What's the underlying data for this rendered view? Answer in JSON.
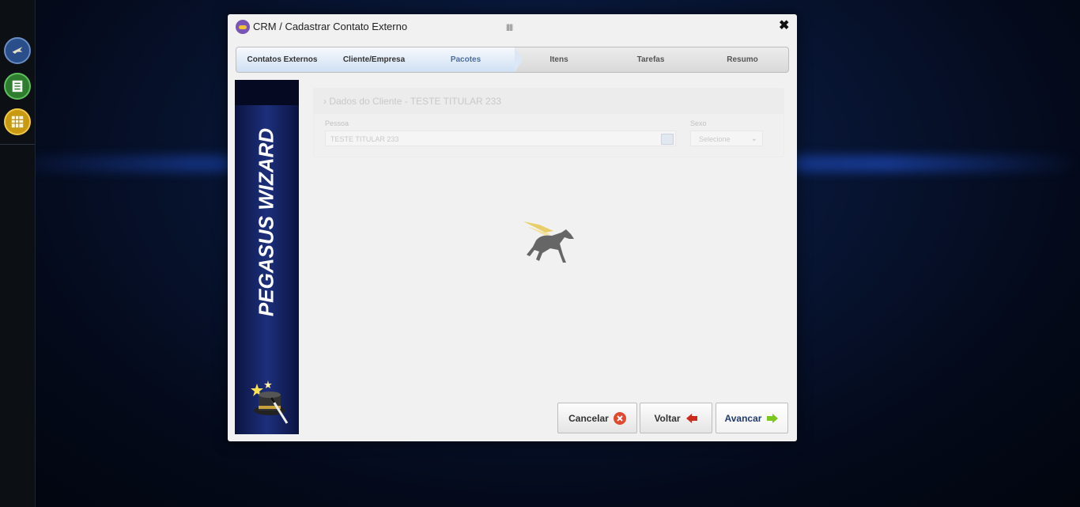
{
  "modal": {
    "title": "CRM / Cadastrar Contato Externo",
    "grip": "||||||",
    "close_symbol": "✖"
  },
  "wizard": {
    "steps": [
      {
        "label": "Contatos Externos",
        "state": "done"
      },
      {
        "label": "Cliente/Empresa",
        "state": "done"
      },
      {
        "label": "Pacotes",
        "state": "current"
      },
      {
        "label": "Itens",
        "state": "pending"
      },
      {
        "label": "Tarefas",
        "state": "pending"
      },
      {
        "label": "Resumo",
        "state": "pending"
      }
    ]
  },
  "banner": {
    "text": "PEGASUS WIZARD"
  },
  "form": {
    "section_title": "› Dados do Cliente - TESTE TITULAR 233",
    "pessoa_label": "Pessoa",
    "pessoa_value": "TESTE TITULAR 233",
    "sexo_label": "Sexo",
    "sexo_value": "Selecione"
  },
  "footer": {
    "cancel_label": "Cancelar",
    "back_label": "Voltar",
    "next_label": "Avancar"
  },
  "rail": {
    "icons": [
      "pegasus-icon",
      "sheet-icon",
      "grid-icon"
    ]
  },
  "colors": {
    "active_step": "#4d6e9c",
    "cancel_icon": "#e0482f",
    "back_icon": "#cc2a1a",
    "next_icon": "#7bc71e"
  }
}
